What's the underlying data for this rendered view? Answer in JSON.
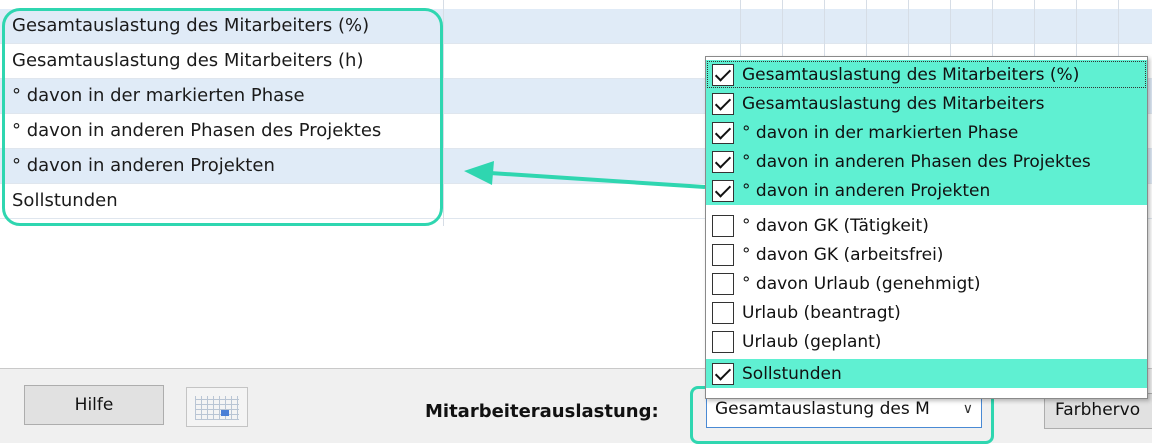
{
  "grid": {
    "rows": [
      {
        "label": "Gesamtauslastung des Mitarbeiters (%)",
        "shade": "alt"
      },
      {
        "label": "Gesamtauslastung des Mitarbeiters (h)",
        "shade": "plain"
      },
      {
        "label": "° davon in der markierten Phase",
        "shade": "alt"
      },
      {
        "label": "° davon in anderen Phasen des Projektes",
        "shade": "plain"
      },
      {
        "label": "° davon in anderen Projekten",
        "shade": "alt"
      },
      {
        "label": "Sollstunden",
        "shade": "plain"
      }
    ]
  },
  "bottom": {
    "help_label": "Hilfe",
    "calendar_icon": "calendar-icon",
    "workload_label": "Mitarbeiterauslastung:",
    "select_value": "Gesamtauslastung des M",
    "color_button_label": "Farbhervo"
  },
  "dropdown": {
    "items": [
      {
        "label": "Gesamtauslastung des Mitarbeiters (%)",
        "checked": true,
        "highlighted": true
      },
      {
        "label": "Gesamtauslastung des Mitarbeiters",
        "checked": true,
        "highlighted": true
      },
      {
        "label": "° davon in der markierten Phase",
        "checked": true,
        "highlighted": true
      },
      {
        "label": "° davon in anderen Phasen des Projektes",
        "checked": true,
        "highlighted": true
      },
      {
        "label": "° davon in anderen Projekten",
        "checked": true,
        "highlighted": true
      },
      {
        "label": "° davon GK (Tätigkeit)",
        "checked": false,
        "highlighted": false
      },
      {
        "label": "° davon GK (arbeitsfrei)",
        "checked": false,
        "highlighted": false
      },
      {
        "label": "° davon Urlaub (genehmigt)",
        "checked": false,
        "highlighted": false
      },
      {
        "label": "Urlaub (beantragt)",
        "checked": false,
        "highlighted": false
      },
      {
        "label": "Urlaub (geplant)",
        "checked": false,
        "highlighted": false
      },
      {
        "label": "Sollstunden",
        "checked": true,
        "highlighted": true
      }
    ]
  },
  "colors": {
    "highlight": "#5ff0d2",
    "annotation": "#2fd6b0",
    "row_alt": "#e0ebf7"
  }
}
